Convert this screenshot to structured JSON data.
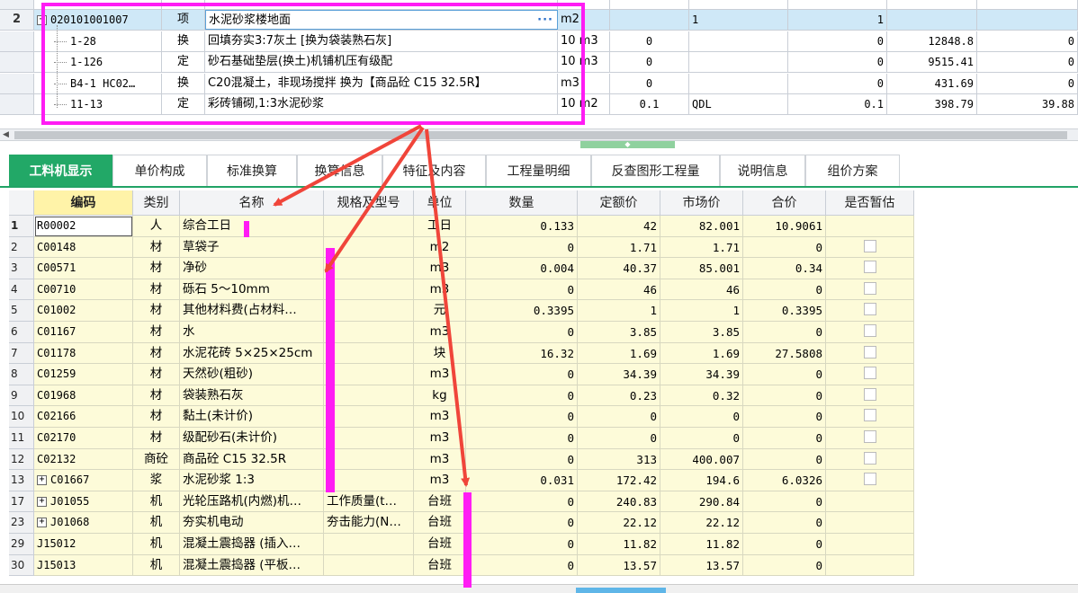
{
  "top_grid": {
    "partial_row": {
      "code": "",
      "type": "",
      "name": "",
      "unit": "",
      "rate": "",
      "qty_expr": "",
      "qty": "",
      "price": "",
      "total": ""
    },
    "rows": [
      {
        "row_no": "2",
        "code": "020101001007",
        "type": "项",
        "name": "水泥砂浆楼地面",
        "unit": "m2",
        "qty_expr": "1",
        "rate": "",
        "qty": "1",
        "price": "",
        "total": "",
        "more": "···"
      },
      {
        "row_no": "",
        "code": "1-28",
        "type": "换",
        "name": "回填夯实3:7灰土  [换为袋装熟石灰]",
        "unit": "10 m3",
        "rate": "0",
        "qty_expr": "",
        "qty": "0",
        "price": "12848.8",
        "total": "0"
      },
      {
        "row_no": "",
        "code": "1-126",
        "type": "定",
        "name": "砂石基础垫层(换土)机铺机压有级配",
        "unit": "10 m3",
        "rate": "0",
        "qty_expr": "",
        "qty": "0",
        "price": "9515.41",
        "total": "0"
      },
      {
        "row_no": "",
        "code": "B4-1 HC02…",
        "type": "换",
        "name": "C20混凝土，非现场搅拌  换为【商品砼 C15 32.5R】",
        "unit": "m3",
        "rate": "0",
        "qty_expr": "",
        "qty": "0",
        "price": "431.69",
        "total": "0"
      },
      {
        "row_no": "",
        "code": "11-13",
        "type": "定",
        "name": "彩砖铺砌,1:3水泥砂浆",
        "unit": "10 m2",
        "rate": "0.1",
        "qty_expr": "QDL",
        "qty": "0.1",
        "price": "398.79",
        "total": "39.88"
      }
    ]
  },
  "tabs": [
    "工料机显示",
    "单价构成",
    "标准换算",
    "换算信息",
    "特征及内容",
    "工程量明细",
    "反查图形工程量",
    "说明信息",
    "组价方案"
  ],
  "grid": {
    "headers": [
      "编码",
      "类别",
      "名称",
      "规格及型号",
      "单位",
      "数量",
      "定额价",
      "市场价",
      "合价",
      "是否暂估"
    ],
    "rows": [
      {
        "n": "1",
        "code": "R00002",
        "type": "人",
        "name": "综合工日",
        "spec": "",
        "unit": "工日",
        "qty": "0.133",
        "quota": "42",
        "market": "82.001",
        "total": "10.9061",
        "expand": false,
        "check": false
      },
      {
        "n": "2",
        "code": "C00148",
        "type": "材",
        "name": "草袋子",
        "spec": "",
        "unit": "m2",
        "qty": "0",
        "quota": "1.71",
        "market": "1.71",
        "total": "0",
        "expand": false,
        "check": true
      },
      {
        "n": "3",
        "code": "C00571",
        "type": "材",
        "name": "净砂",
        "spec": "",
        "unit": "m3",
        "qty": "0.004",
        "quota": "40.37",
        "market": "85.001",
        "total": "0.34",
        "expand": false,
        "check": true
      },
      {
        "n": "4",
        "code": "C00710",
        "type": "材",
        "name": "砾石 5～10mm",
        "spec": "",
        "unit": "m3",
        "qty": "0",
        "quota": "46",
        "market": "46",
        "total": "0",
        "expand": false,
        "check": true
      },
      {
        "n": "5",
        "code": "C01002",
        "type": "材",
        "name": "其他材料费(占材料…",
        "spec": "",
        "unit": "元",
        "qty": "0.3395",
        "quota": "1",
        "market": "1",
        "total": "0.3395",
        "expand": false,
        "check": true
      },
      {
        "n": "6",
        "code": "C01167",
        "type": "材",
        "name": "水",
        "spec": "",
        "unit": "m3",
        "qty": "0",
        "quota": "3.85",
        "market": "3.85",
        "total": "0",
        "expand": false,
        "check": true
      },
      {
        "n": "7",
        "code": "C01178",
        "type": "材",
        "name": "水泥花砖 5×25×25cm",
        "spec": "",
        "unit": "块",
        "qty": "16.32",
        "quota": "1.69",
        "market": "1.69",
        "total": "27.5808",
        "expand": false,
        "check": true
      },
      {
        "n": "8",
        "code": "C01259",
        "type": "材",
        "name": "天然砂(粗砂)",
        "spec": "",
        "unit": "m3",
        "qty": "0",
        "quota": "34.39",
        "market": "34.39",
        "total": "0",
        "expand": false,
        "check": true
      },
      {
        "n": "9",
        "code": "C01968",
        "type": "材",
        "name": "袋装熟石灰",
        "spec": "",
        "unit": "kg",
        "qty": "0",
        "quota": "0.23",
        "market": "0.32",
        "total": "0",
        "expand": false,
        "check": true
      },
      {
        "n": "10",
        "code": "C02166",
        "type": "材",
        "name": "黏土(未计价)",
        "spec": "",
        "unit": "m3",
        "qty": "0",
        "quota": "0",
        "market": "0",
        "total": "0",
        "expand": false,
        "check": true
      },
      {
        "n": "11",
        "code": "C02170",
        "type": "材",
        "name": "级配砂石(未计价)",
        "spec": "",
        "unit": "m3",
        "qty": "0",
        "quota": "0",
        "market": "0",
        "total": "0",
        "expand": false,
        "check": true
      },
      {
        "n": "12",
        "code": "C02132",
        "type": "商砼",
        "name": "商品砼 C15 32.5R",
        "spec": "",
        "unit": "m3",
        "qty": "0",
        "quota": "313",
        "market": "400.007",
        "total": "0",
        "expand": false,
        "check": true
      },
      {
        "n": "13",
        "code": "C01667",
        "type": "浆",
        "name": "水泥砂浆 1:3",
        "spec": "",
        "unit": "m3",
        "qty": "0.031",
        "quota": "172.42",
        "market": "194.6",
        "total": "6.0326",
        "expand": true,
        "check": true
      },
      {
        "n": "17",
        "code": "J01055",
        "type": "机",
        "name": "光轮压路机(内燃)机…",
        "spec": "工作质量(t…",
        "unit": "台班",
        "qty": "0",
        "quota": "240.83",
        "market": "290.84",
        "total": "0",
        "expand": true,
        "check": false
      },
      {
        "n": "23",
        "code": "J01068",
        "type": "机",
        "name": "夯实机电动",
        "spec": "夯击能力(N…",
        "unit": "台班",
        "qty": "0",
        "quota": "22.12",
        "market": "22.12",
        "total": "0",
        "expand": true,
        "check": false
      },
      {
        "n": "29",
        "code": "J15012",
        "type": "机",
        "name": "混凝土震捣器 (插入…",
        "spec": "",
        "unit": "台班",
        "qty": "0",
        "quota": "11.82",
        "market": "11.82",
        "total": "0",
        "expand": false,
        "check": false
      },
      {
        "n": "30",
        "code": "J15013",
        "type": "机",
        "name": "混凝土震捣器 (平板…",
        "spec": "",
        "unit": "台班",
        "qty": "0",
        "quota": "13.57",
        "market": "13.57",
        "total": "0",
        "expand": false,
        "check": false
      }
    ]
  },
  "colors": {
    "tab_active": "#22a867",
    "highlight": "#ff1cf4",
    "arrow": "#f0453a",
    "row_yellow": "#fdfbd9",
    "selected_row": "#cfe8f7"
  }
}
